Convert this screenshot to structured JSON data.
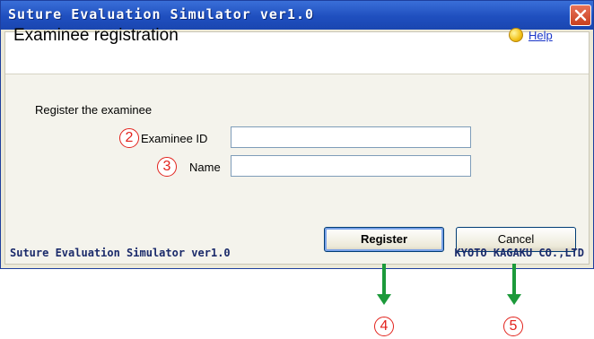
{
  "window": {
    "title": "Suture Evaluation Simulator ver1.0"
  },
  "header": {
    "heading": "Examinee registration",
    "help_label": "Help"
  },
  "form": {
    "prompt": "Register the examinee",
    "examinee_id": {
      "label": "Examinee ID",
      "value": "",
      "marker": "2"
    },
    "name": {
      "label": "Name",
      "value": "",
      "marker": "3"
    }
  },
  "buttons": {
    "register": {
      "label": "Register",
      "marker": "4"
    },
    "cancel": {
      "label": "Cancel",
      "marker": "5"
    }
  },
  "footer": {
    "left": "Suture Evaluation Simulator ver1.0",
    "right": "KYOTO KAGAKU CO.,LTD"
  },
  "colors": {
    "annotation_red": "#e2221c",
    "annotation_green": "#1c9a3a",
    "titlebar_blue": "#1f4fbf"
  },
  "icons": {
    "close": "close-icon",
    "help": "help-icon"
  }
}
